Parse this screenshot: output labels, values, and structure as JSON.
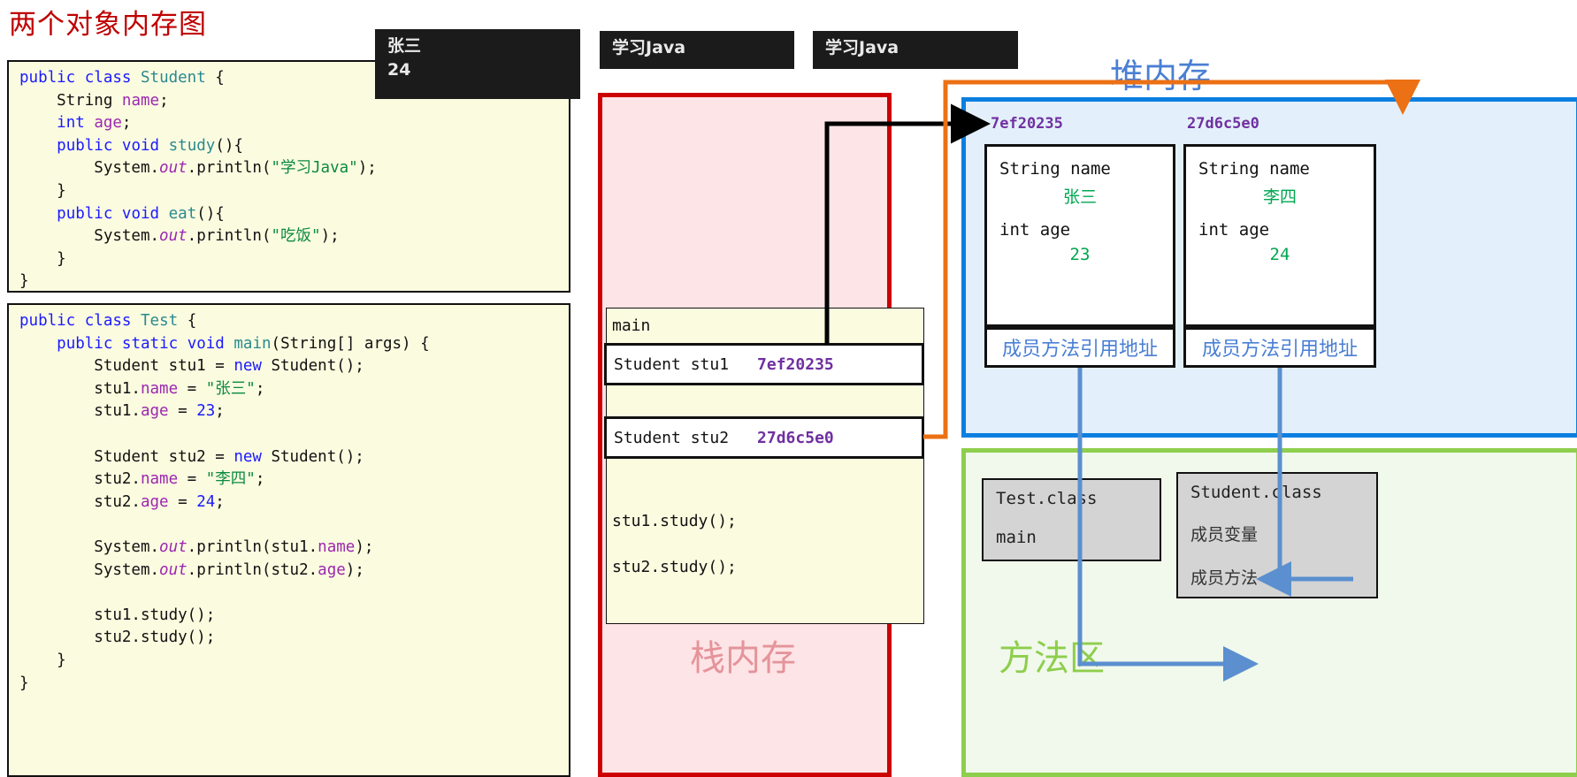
{
  "page": {
    "title": "两个对象内存图"
  },
  "code_student": {
    "lines": [
      "public class Student {",
      "    String name;",
      "    int age;",
      "    public void study(){",
      "        System.out.println(\"学习Java\");",
      "    }",
      "    public void eat(){",
      "        System.out.println(\"吃饭\");",
      "    }",
      "}"
    ]
  },
  "code_test": {
    "lines": [
      "public class Test {",
      "    public static void main(String[] args) {",
      "        Student stu1 = new Student();",
      "        stu1.name = \"张三\";",
      "        stu1.age = 23;",
      "",
      "        Student stu2 = new Student();",
      "        stu2.name = \"李四\";",
      "        stu2.age = 24;",
      "",
      "        System.out.println(stu1.name);",
      "        System.out.println(stu2.age);",
      "",
      "        stu1.study();",
      "        stu2.study();",
      "    }",
      "}"
    ]
  },
  "consoles": [
    {
      "name": "console-name-age",
      "text": "张三\n24"
    },
    {
      "name": "console-study-1",
      "text": "学习Java"
    },
    {
      "name": "console-study-2",
      "text": "学习Java"
    }
  ],
  "stack": {
    "label": "栈内存",
    "frame_name": "main",
    "variables": [
      {
        "declaration": "Student stu1",
        "address": "7ef20235"
      },
      {
        "declaration": "Student stu2",
        "address": "27d6c5e0"
      }
    ],
    "calls": [
      "stu1.study();",
      "stu2.study();"
    ]
  },
  "heap": {
    "label": "堆内存",
    "objects": [
      {
        "address": "7ef20235",
        "field_name_decl": "String name",
        "field_name_value": "张三",
        "field_age_decl": "int age",
        "field_age_value": "23",
        "method_ref": "成员方法引用地址"
      },
      {
        "address": "27d6c5e0",
        "field_name_decl": "String name",
        "field_name_value": "李四",
        "field_age_decl": "int age",
        "field_age_value": "24",
        "method_ref": "成员方法引用地址"
      }
    ]
  },
  "method_area": {
    "label": "方法区",
    "classes": [
      {
        "title": "Test.class",
        "entries": [
          "main"
        ]
      },
      {
        "title": "Student.class",
        "entries": [
          "成员变量",
          "成员方法"
        ]
      }
    ]
  },
  "colors": {
    "title_red": "#c00000",
    "stack_border": "#cc0000",
    "stack_bg": "#fde4e6",
    "heap_border": "#0b7fe0",
    "heap_bg": "#e3f0fb",
    "method_border": "#8ece4d",
    "method_bg": "#f1f9ec",
    "address_purple": "#7030a0",
    "value_green": "#00a650",
    "orange_arrow": "#ec7014",
    "blue_arrow": "#5b8fcf"
  }
}
